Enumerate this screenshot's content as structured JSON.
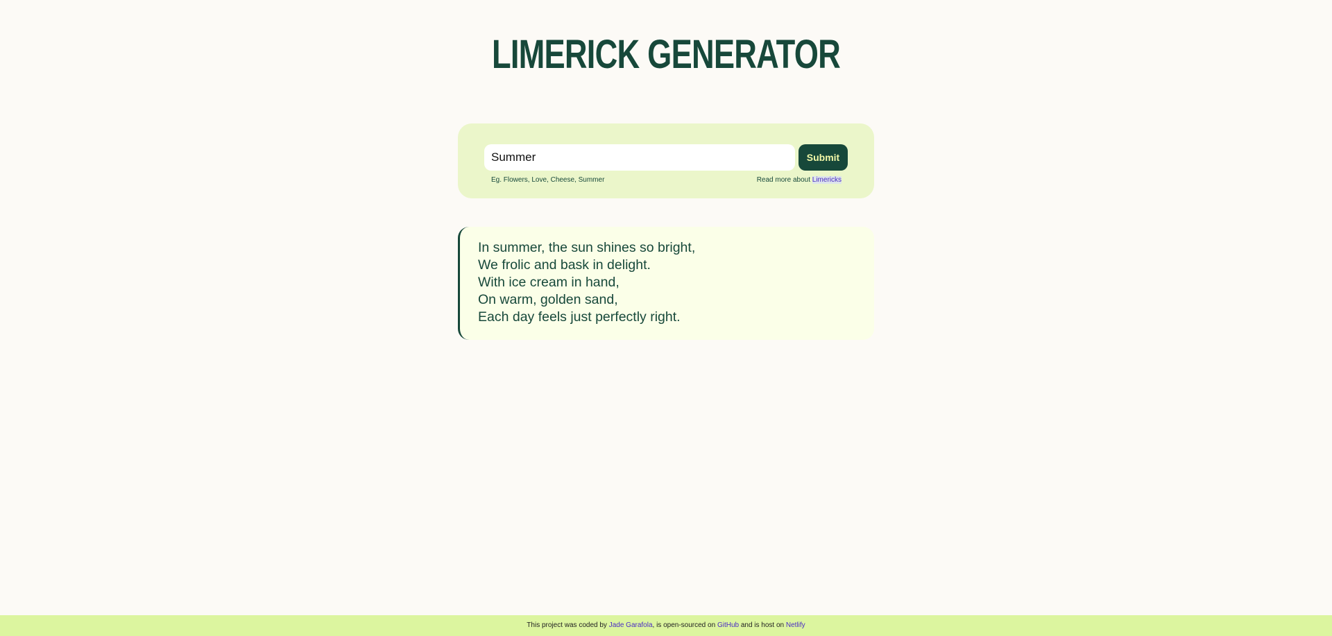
{
  "header": {
    "title": "LIMERICK GENERATOR"
  },
  "form": {
    "input_value": "Summer",
    "submit_label": "Submit",
    "hint": "Eg. Flowers, Love, Cheese, Summer",
    "read_more_text": "Read more about",
    "read_more_link": "Limericks"
  },
  "poem": {
    "lines": [
      "In summer, the sun shines so bright,",
      "We frolic and bask in delight.",
      "With ice cream in hand,",
      "On warm, golden sand,",
      "Each day feels just perfectly right."
    ]
  },
  "footer": {
    "prefix": "This project was coded by",
    "author": "Jade Garafola",
    "middle": ", is open-sourced on",
    "github": "GitHub",
    "connector": "and is host on",
    "netlify": "Netlify"
  },
  "colors": {
    "background": "#fcfaf6",
    "primary": "#17483a",
    "form_card": "#ebf6ca",
    "poem_card": "#fbffe8",
    "footer": "#dcf59f",
    "link": "#4a2cc4",
    "button_text": "#f3f9a8"
  }
}
